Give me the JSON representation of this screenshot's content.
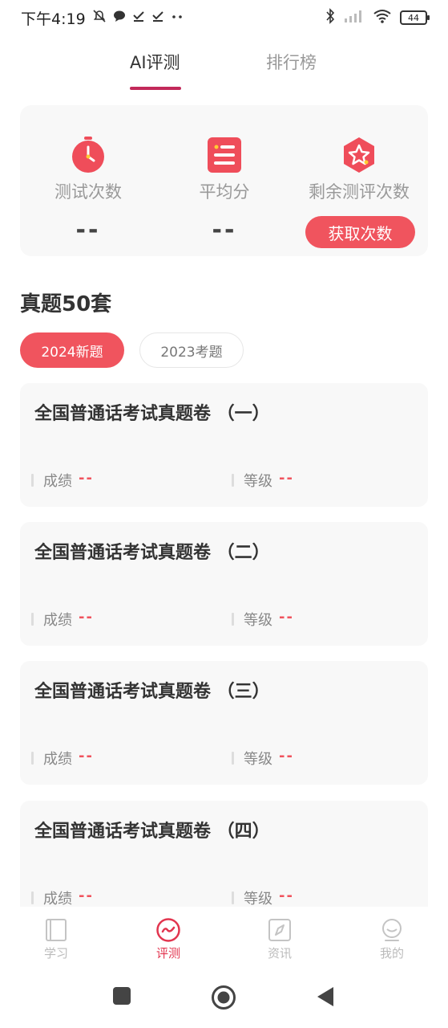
{
  "status_bar": {
    "time": "下午4:19",
    "battery": "44"
  },
  "tabs": [
    {
      "label": "AI评测",
      "active": true
    },
    {
      "label": "排行榜",
      "active": false
    }
  ],
  "stats": {
    "test_count": {
      "label": "测试次数",
      "value": "--",
      "icon": "stopwatch-icon"
    },
    "avg_score": {
      "label": "平均分",
      "value": "--",
      "icon": "list-icon"
    },
    "remaining": {
      "label": "剩余测评次数",
      "button": "获取次数",
      "icon": "star-badge-icon"
    }
  },
  "section_title": "真题50套",
  "filters": [
    {
      "label": "2024新题",
      "active": true
    },
    {
      "label": "2023考题",
      "active": false
    }
  ],
  "exams": [
    {
      "title": "全国普通话考试真题卷 （一）",
      "score_label": "成绩",
      "score": "--",
      "level_label": "等级",
      "level": "--"
    },
    {
      "title": "全国普通话考试真题卷 （二）",
      "score_label": "成绩",
      "score": "--",
      "level_label": "等级",
      "level": "--"
    },
    {
      "title": "全国普通话考试真题卷 （三）",
      "score_label": "成绩",
      "score": "--",
      "level_label": "等级",
      "level": "--"
    },
    {
      "title": "全国普通话考试真题卷 （四）",
      "score_label": "成绩",
      "score": "--",
      "level_label": "等级",
      "level": "--"
    }
  ],
  "bottom_nav": [
    {
      "label": "学习",
      "icon": "book-icon",
      "active": false
    },
    {
      "label": "评测",
      "icon": "eval-icon",
      "active": true
    },
    {
      "label": "资讯",
      "icon": "compass-icon",
      "active": false
    },
    {
      "label": "我的",
      "icon": "profile-icon",
      "active": false
    }
  ],
  "colors": {
    "accent": "#f0545e",
    "tab_underline": "#c2295a",
    "card_bg": "#f8f8f8"
  }
}
